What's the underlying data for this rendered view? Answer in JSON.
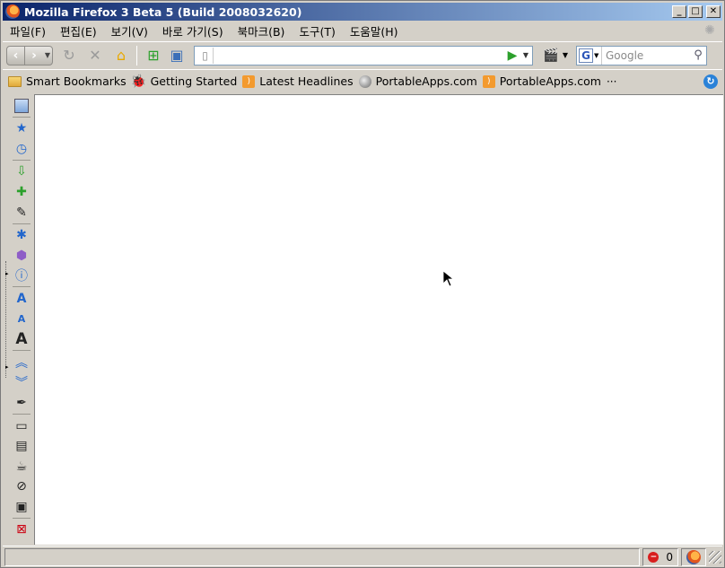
{
  "window": {
    "title": "Mozilla Firefox 3 Beta 5 (Build 2008032620)",
    "buttons": {
      "minimize": "_",
      "maximize": "□",
      "close": "✕"
    }
  },
  "menubar": {
    "items": [
      {
        "label": "파일(F)"
      },
      {
        "label": "편집(E)"
      },
      {
        "label": "보기(V)"
      },
      {
        "label": "바로 가기(S)"
      },
      {
        "label": "북마크(B)"
      },
      {
        "label": "도구(T)"
      },
      {
        "label": "도움말(H)"
      }
    ]
  },
  "navbar": {
    "url_value": "",
    "search_placeholder": "Google",
    "search_engine": "G"
  },
  "bookmarks": {
    "items": [
      {
        "label": "Smart Bookmarks",
        "icon": "folder-icon"
      },
      {
        "label": "Getting Started",
        "icon": "bug-icon"
      },
      {
        "label": "Latest Headlines",
        "icon": "rss-icon"
      },
      {
        "label": "PortableApps.com",
        "icon": "portableapps-icon"
      },
      {
        "label": "PortableApps.com",
        "icon": "rss-icon"
      }
    ],
    "more": "···"
  },
  "status": {
    "blocked_count": "0"
  }
}
